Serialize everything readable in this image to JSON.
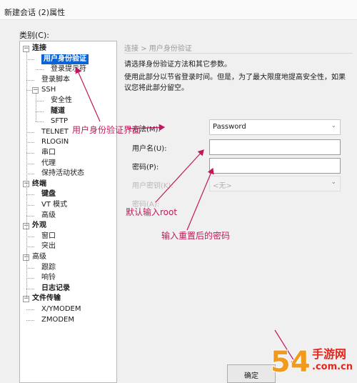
{
  "window": {
    "title": "新建会话 (2)属性"
  },
  "category_label": "类别(C):",
  "tree": [
    {
      "label": "连接",
      "bold": true,
      "depth": 0,
      "expanded": true
    },
    {
      "label": "用户身份验证",
      "bold": true,
      "depth": 1,
      "selected": true
    },
    {
      "label": "登录提示符",
      "depth": 2
    },
    {
      "label": "登录脚本",
      "depth": 1
    },
    {
      "label": "SSH",
      "depth": 1,
      "expanded": true
    },
    {
      "label": "安全性",
      "depth": 2
    },
    {
      "label": "隧道",
      "bold": true,
      "depth": 2
    },
    {
      "label": "SFTP",
      "depth": 2
    },
    {
      "label": "TELNET",
      "depth": 1
    },
    {
      "label": "RLOGIN",
      "depth": 1
    },
    {
      "label": "串口",
      "depth": 1
    },
    {
      "label": "代理",
      "depth": 1
    },
    {
      "label": "保持活动状态",
      "depth": 1
    },
    {
      "label": "终端",
      "bold": true,
      "depth": 0,
      "expanded": true
    },
    {
      "label": "键盘",
      "bold": true,
      "depth": 1
    },
    {
      "label": "VT 模式",
      "depth": 1
    },
    {
      "label": "高级",
      "depth": 1
    },
    {
      "label": "外观",
      "bold": true,
      "depth": 0,
      "expanded": true
    },
    {
      "label": "窗口",
      "depth": 1
    },
    {
      "label": "突出",
      "depth": 1
    },
    {
      "label": "高级",
      "depth": 0,
      "expanded": true
    },
    {
      "label": "跟踪",
      "depth": 1
    },
    {
      "label": "响铃",
      "depth": 1
    },
    {
      "label": "日志记录",
      "bold": true,
      "depth": 1
    },
    {
      "label": "文件传输",
      "bold": true,
      "depth": 0,
      "expanded": true
    },
    {
      "label": "X/YMODEM",
      "depth": 1
    },
    {
      "label": "ZMODEM",
      "depth": 1
    }
  ],
  "panel": {
    "breadcrumb": "连接 > 用户身份验证",
    "description": [
      "请选择身份验证方法和其它参数。",
      "使用此部分以节省登录时间。但是，为了最大限度地提高安全性，如果",
      "议您将此部分留空。"
    ],
    "method_label": "方法(M):",
    "method_value": "Password",
    "username_label": "用户名(U):",
    "username_value": "",
    "password_label": "密码(P):",
    "password_value": "",
    "user_key_label": "用户密钥(K):",
    "user_key_value": "<无>",
    "passphrase_label": "密码(A):"
  },
  "annotations": {
    "auth_ui": "用户身份验证界面",
    "default_root": "默认输入root",
    "reset_password": "输入重置后的密码"
  },
  "footer": {
    "ok_label": "确定"
  },
  "watermark": {
    "logo_text": "54⒑",
    "site_name": "手游网",
    "site_domain": ".com.cn"
  },
  "colors": {
    "selection": "#0a64d8",
    "annotation": "#c2185b",
    "watermark": "#e0281f"
  }
}
